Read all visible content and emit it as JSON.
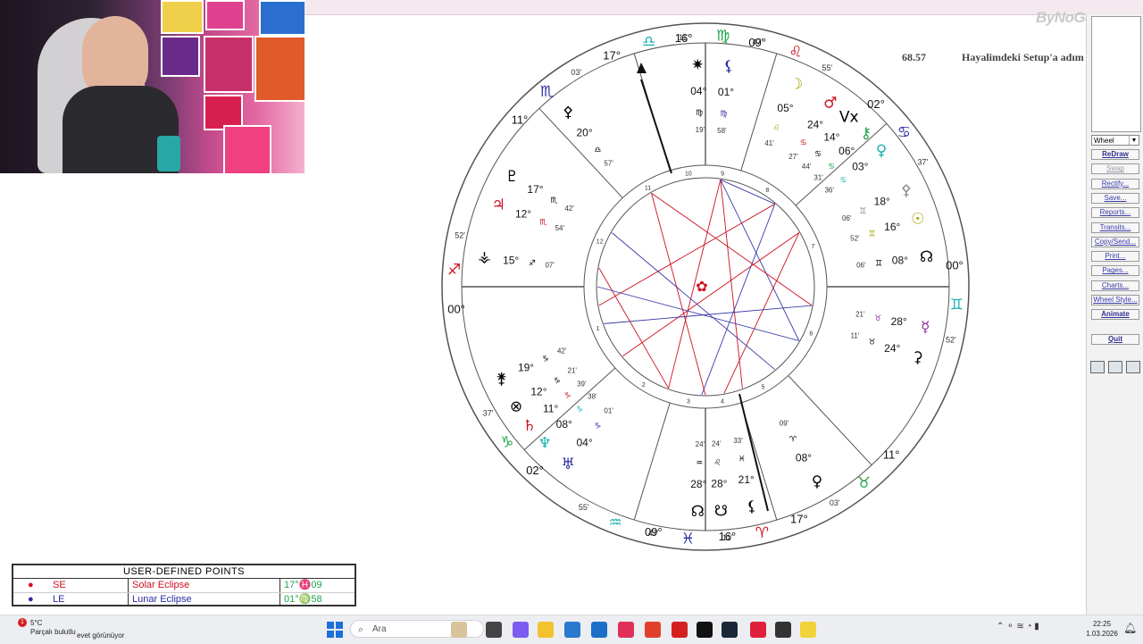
{
  "overlay": {
    "score": "68.57",
    "stream_title": "Hayalimdeki Setup'a adım adım! :)",
    "logo": "ByNoGame"
  },
  "side_panel": {
    "chart_select": "Wheel",
    "buttons": [
      {
        "label": "ReDraw",
        "enabled": true,
        "bold": true
      },
      {
        "label": "Swap",
        "enabled": false
      },
      {
        "label": "Rectify...",
        "enabled": true
      },
      {
        "label": "Save...",
        "enabled": true
      },
      {
        "label": "Reports...",
        "enabled": true
      },
      {
        "label": "Transits...",
        "enabled": true
      },
      {
        "label": "Copy/Send...",
        "enabled": true
      },
      {
        "label": "Print...",
        "enabled": true
      },
      {
        "label": "Pages...",
        "enabled": true
      },
      {
        "label": "Charts...",
        "enabled": true
      },
      {
        "label": "Wheel Style...",
        "enabled": true
      },
      {
        "label": "Animate",
        "enabled": true,
        "bold": true
      }
    ],
    "quit": "Quit"
  },
  "user_defined_points": {
    "title": "USER-DEFINED POINTS",
    "rows": [
      {
        "glyph": "SE-icon",
        "code": "SE",
        "name": "Solar Eclipse",
        "position": "17°♓09",
        "color": "#cc1020"
      },
      {
        "glyph": "LE-icon",
        "code": "LE",
        "name": "Lunar Eclipse",
        "position": "01°♍58",
        "color": "#2a2aa0"
      }
    ]
  },
  "wheel": {
    "signs": [
      {
        "deg": "16°",
        "min": "47'",
        "glyph": "♍",
        "color": "#1fa64a"
      },
      {
        "deg": "09°",
        "min": "55'",
        "glyph": "♌",
        "color": "#cc1020"
      },
      {
        "deg": "02°",
        "min": "37'",
        "glyph": "♋",
        "color": "#2a2aa0"
      },
      {
        "deg": "00°",
        "min": "52'",
        "glyph": "♊",
        "color": "#1ab0b0"
      },
      {
        "deg": "11°",
        "min": "03'",
        "glyph": "♉",
        "color": "#1fa64a"
      },
      {
        "deg": "17°",
        "min": "11'",
        "glyph": "♈",
        "color": "#cc1020"
      },
      {
        "deg": "16°",
        "min": "47'",
        "glyph": "♓",
        "color": "#2a2aa0"
      },
      {
        "deg": "09°",
        "min": "55'",
        "glyph": "♒",
        "color": "#1ab0b0"
      },
      {
        "deg": "02°",
        "min": "37'",
        "glyph": "♑",
        "color": "#1fa64a"
      },
      {
        "deg": "00°",
        "min": "52'",
        "glyph": "♐",
        "color": "#cc1020"
      },
      {
        "deg": "11°",
        "min": "03'",
        "glyph": "♏",
        "color": "#2a2aa0"
      },
      {
        "deg": "17°",
        "min": "11'",
        "glyph": "♎",
        "color": "#1ab0b0"
      }
    ],
    "houses": [
      "9",
      "8",
      "7",
      "6",
      "5",
      "4",
      "3",
      "2",
      "1",
      "12",
      "11",
      "10"
    ],
    "planets": [
      {
        "glyph": "☽",
        "deg": "05°",
        "min": "41'",
        "sign": "♌",
        "color": "#a8a000"
      },
      {
        "glyph": "♂",
        "deg": "24°",
        "min": "27'",
        "sign": "♋",
        "color": "#cc1020"
      },
      {
        "glyph": "Vx",
        "deg": "14°",
        "min": "44'",
        "sign": "♋",
        "color": "#000000"
      },
      {
        "glyph": "⚷",
        "deg": "06°",
        "min": "31'",
        "sign": "♋",
        "color": "#1fa64a"
      },
      {
        "glyph": "♀",
        "deg": "03°",
        "min": "36'",
        "sign": "♋",
        "color": "#1ab0b0"
      },
      {
        "glyph": "⚴",
        "deg": "18°",
        "min": "06'",
        "sign": "♊",
        "color": "#888888"
      },
      {
        "glyph": "☉",
        "deg": "16°",
        "min": "52'",
        "sign": "♊",
        "color": "#a8a000"
      },
      {
        "glyph": "☊",
        "deg": "08°",
        "min": "06'",
        "sign": "♊",
        "color": "#000000"
      },
      {
        "glyph": "☿",
        "deg": "28°",
        "min": "21'",
        "sign": "♉",
        "color": "#8a2aa0"
      },
      {
        "glyph": "⚳",
        "deg": "24°",
        "min": "11'",
        "sign": "♉",
        "color": "#000000"
      },
      {
        "glyph": "♀",
        "deg": "08°",
        "min": "09'",
        "sign": "♈",
        "color": "#000000"
      },
      {
        "glyph": "⚸",
        "deg": "21°",
        "min": "33'",
        "sign": "♓",
        "color": "#000000"
      },
      {
        "glyph": "☊",
        "deg": "28°",
        "min": "24'",
        "sign": "♒",
        "color": "#000000"
      },
      {
        "glyph": "♅",
        "deg": "04°",
        "min": "01'",
        "sign": "♑",
        "color": "#2a2aa0"
      },
      {
        "glyph": "♆",
        "deg": "08°",
        "min": "38'",
        "sign": "♑",
        "color": "#1ab0b0"
      },
      {
        "glyph": "♄",
        "deg": "11°",
        "min": "39'",
        "sign": "♑",
        "color": "#cc1020"
      },
      {
        "glyph": "⊗",
        "deg": "12°",
        "min": "21'",
        "sign": "♑",
        "color": "#000000"
      },
      {
        "glyph": "⚵",
        "deg": "19°",
        "min": "42'",
        "sign": "♑",
        "color": "#000000"
      },
      {
        "glyph": "⚶",
        "deg": "15°",
        "min": "07'",
        "sign": "♐",
        "color": "#000000"
      },
      {
        "glyph": "♃",
        "deg": "12°",
        "min": "54'",
        "sign": "♏",
        "color": "#cc1020"
      },
      {
        "glyph": "♇",
        "deg": "17°",
        "min": "42'",
        "sign": "♏",
        "color": "#000000"
      },
      {
        "glyph": "⚴",
        "deg": "20°",
        "min": "57'",
        "sign": "♎",
        "color": "#000000"
      },
      {
        "glyph": "✷",
        "deg": "04°",
        "min": "19'",
        "sign": "♍",
        "color": "#000000"
      },
      {
        "glyph": "⚸",
        "deg": "01°",
        "min": "58'",
        "sign": "♍",
        "color": "#2a2aa0"
      },
      {
        "glyph": "☋",
        "deg": "28°",
        "min": "24'",
        "sign": "♌",
        "color": "#000000"
      }
    ]
  },
  "taskbar": {
    "weather_temp": "5°C",
    "weather_text": "Parçalı bulutlu",
    "search_placeholder": "Ara",
    "time": "22:25",
    "date": "1.03.2026",
    "notification_text": "evet görünüyor"
  }
}
